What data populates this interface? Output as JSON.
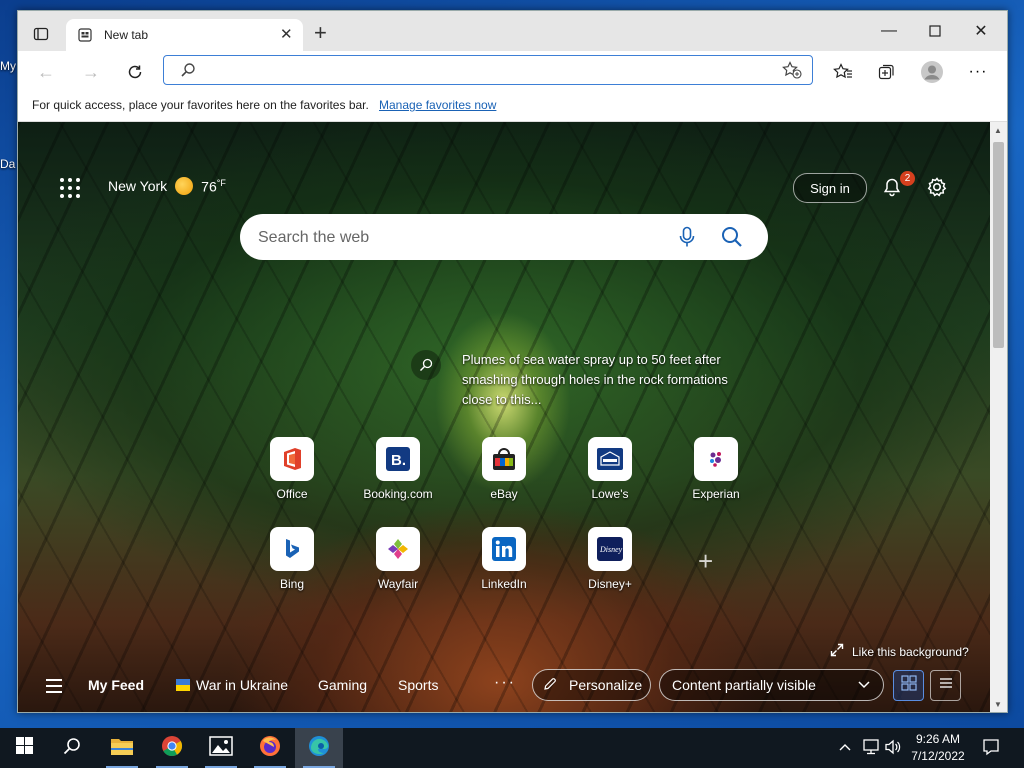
{
  "desktop": {
    "icon_labels": [
      "My",
      "Da"
    ]
  },
  "browser": {
    "tab": {
      "title": "New tab"
    },
    "address": {
      "value": "",
      "placeholder": ""
    },
    "favorites_bar": {
      "message": "For quick access, place your favorites here on the favorites bar.",
      "link": "Manage favorites now"
    }
  },
  "ntp": {
    "weather": {
      "city": "New York",
      "temp": "76",
      "unit": "°F"
    },
    "sign_in": "Sign in",
    "notifications_count": "2",
    "search": {
      "placeholder": "Search the web"
    },
    "image_info": "Plumes of sea water spray up to 50 feet after smashing through holes in the rock formations close to this...",
    "quick_links": [
      {
        "label": "Office",
        "icon": "office-icon"
      },
      {
        "label": "Booking.com",
        "icon": "booking-icon"
      },
      {
        "label": "eBay",
        "icon": "ebay-icon"
      },
      {
        "label": "Lowe's",
        "icon": "lowes-icon"
      },
      {
        "label": "Experian",
        "icon": "experian-icon"
      },
      {
        "label": "Bing",
        "icon": "bing-icon"
      },
      {
        "label": "Wayfair",
        "icon": "wayfair-icon"
      },
      {
        "label": "LinkedIn",
        "icon": "linkedin-icon"
      },
      {
        "label": "Disney+",
        "icon": "disney-plus-icon"
      }
    ],
    "like_background": "Like this background?",
    "feed": {
      "my_feed": "My Feed",
      "items": [
        "War in Ukraine",
        "Gaming",
        "Sports"
      ],
      "more": "···",
      "personalize": "Personalize",
      "content_visibility": "Content partially visible"
    }
  },
  "taskbar": {
    "time": "9:26 AM",
    "date": "7/12/2022",
    "apps": [
      "file-explorer-icon",
      "chrome-icon",
      "photos-icon",
      "firefox-icon",
      "edge-icon"
    ]
  },
  "colors": {
    "accent": "#1a62b5",
    "notification_badge": "#d5401e",
    "taskbar": "#101820"
  }
}
